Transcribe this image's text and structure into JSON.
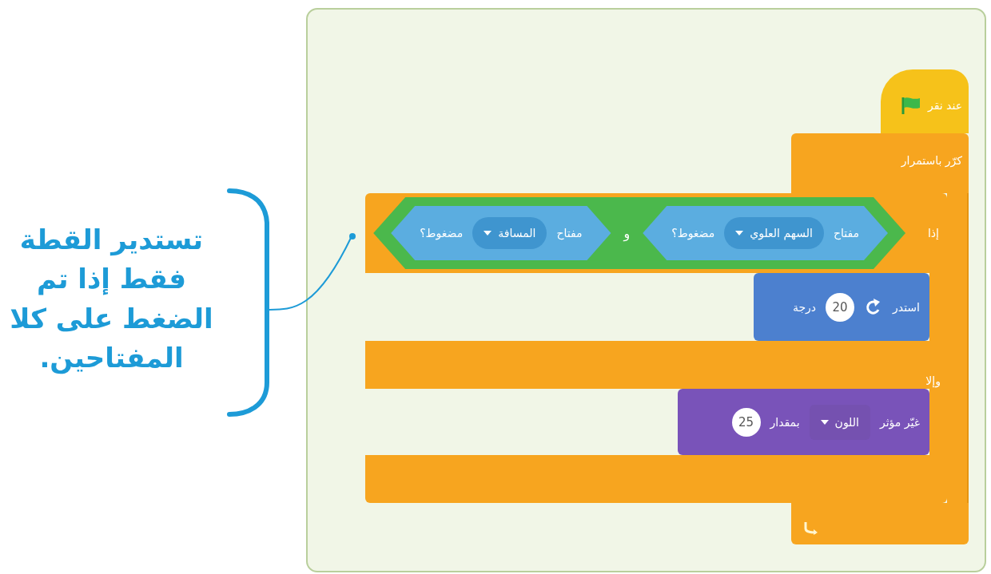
{
  "callout": {
    "lines": [
      "تستدير القطة",
      "فقط إذا تم",
      "الضغط على كلا",
      "المفتاحين."
    ]
  },
  "script": {
    "hat": {
      "label": "عند نقر"
    },
    "forever": {
      "label": "كرّر باستمرار"
    },
    "if_else": {
      "if_label": "إذا",
      "condition": {
        "operator": "و",
        "operands": [
          {
            "prefix": "مفتاح",
            "key": "السهم العلوي",
            "suffix": "مضغوط؟"
          },
          {
            "prefix": "مفتاح",
            "key": "المسافة",
            "suffix": "مضغوط؟"
          }
        ]
      },
      "then": [
        {
          "kind": "turn",
          "label": "استدر",
          "value": "20",
          "unit": "درجة"
        }
      ],
      "else_label": "وإلا",
      "else": [
        {
          "kind": "change_effect",
          "label": "غيّر مؤثر",
          "option": "اللون",
          "by": "بمقدار",
          "value": "25"
        }
      ]
    }
  }
}
